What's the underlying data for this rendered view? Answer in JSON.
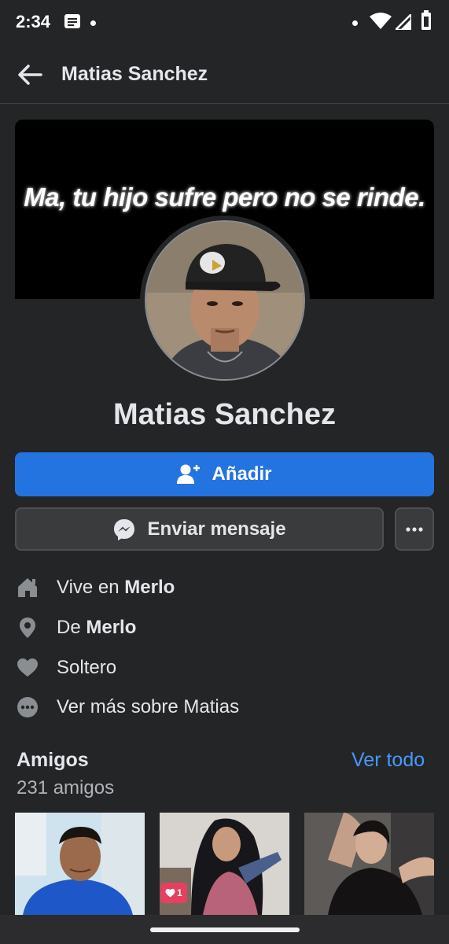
{
  "status_bar": {
    "time": "2:34",
    "icons": [
      "message-notification-icon",
      "dot-icon",
      "dot-icon",
      "wifi-icon",
      "cell-signal-icon",
      "battery-icon"
    ]
  },
  "app_bar": {
    "title": "Matias Sanchez",
    "back_icon": "arrow-left-icon"
  },
  "profile": {
    "cover_text": "Ma, tu hijo sufre pero no se rinde.",
    "name": "Matias Sanchez"
  },
  "actions": {
    "add_label": "Añadir",
    "message_label": "Enviar mensaje",
    "more_icon": "more-horizontal-icon"
  },
  "info": {
    "lives_prefix": "Vive en ",
    "lives_value": "Merlo",
    "from_prefix": "De ",
    "from_value": "Merlo",
    "relationship": "Soltero",
    "see_more": "Ver más sobre Matias"
  },
  "friends": {
    "title": "Amigos",
    "count": "231 amigos",
    "see_all": "Ver todo",
    "badge": "1"
  },
  "colors": {
    "background": "#242526",
    "primary_button": "#2374e1",
    "secondary_button": "#3a3b3c",
    "link": "#4599ff",
    "text": "#e4e6eb",
    "muted_text": "#b0b3b8"
  }
}
